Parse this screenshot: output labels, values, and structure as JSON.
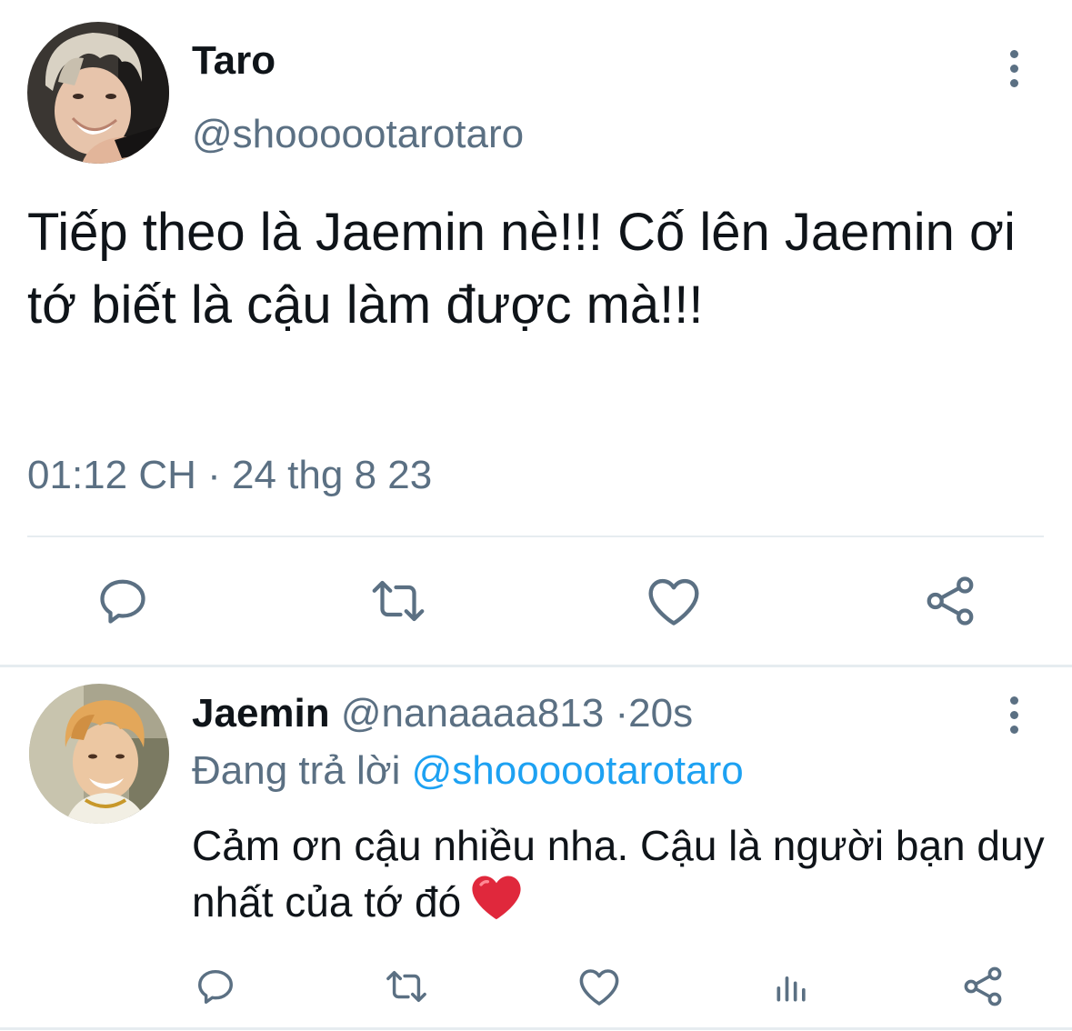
{
  "main_tweet": {
    "author": {
      "name": "Taro",
      "handle": "@shoooootarotaro"
    },
    "text": "Tiếp theo là Jaemin nè!!! Cố lên Jaemin ơi tớ biết là cậu làm được mà!!!",
    "time": "01:12 CH",
    "date": "24 thg 8 23",
    "time_separator": "·",
    "actions": [
      "reply-icon",
      "retweet-icon",
      "like-icon",
      "share-icon"
    ]
  },
  "reply": {
    "author": {
      "name": "Jaemin",
      "handle": "@nanaaaa813",
      "age": "20s",
      "separator": "·"
    },
    "replying_to_label": "Đang trả lời",
    "replying_to_handle": "@shoooootarotaro",
    "text": "Cảm ơn cậu nhiều nha. Cậu là người bạn duy nhất của tớ đó",
    "emoji": "red-heart-emoji",
    "actions": [
      "reply-icon",
      "retweet-icon",
      "like-icon",
      "analytics-icon",
      "share-icon"
    ]
  },
  "colors": {
    "text_primary": "#0f1419",
    "text_secondary": "#5b7083",
    "link": "#1da1f2",
    "divider": "#e6ecf0",
    "heart_emoji": "#e0283c"
  }
}
